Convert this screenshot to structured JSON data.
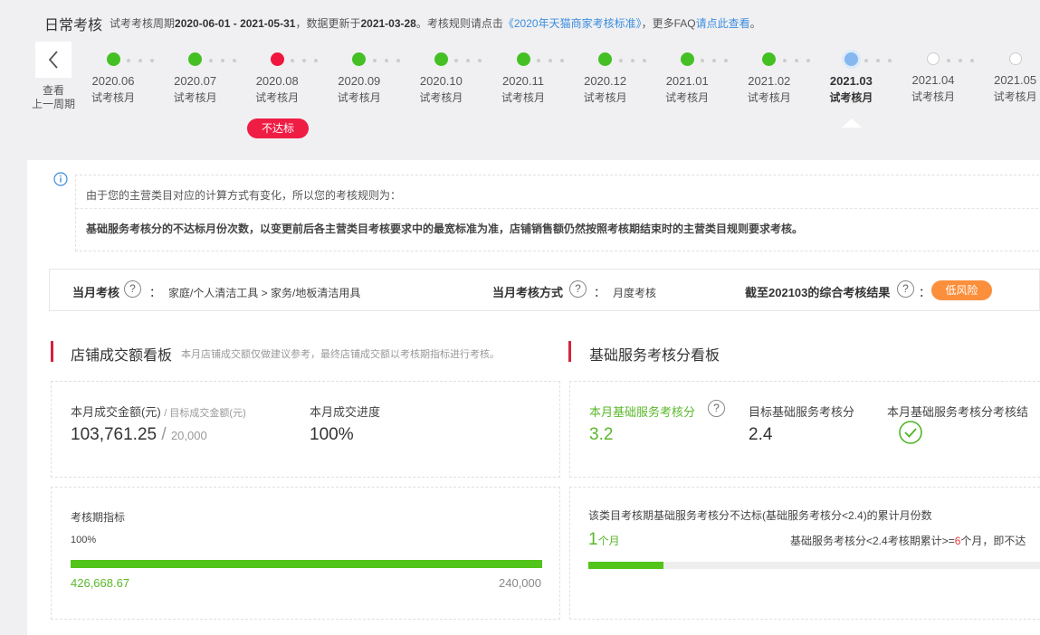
{
  "header": {
    "title": "日常考核",
    "desc_prefix": "试考考核周期",
    "period": "2020-06-01 - 2021-05-31",
    "desc_mid": "，数据更新于",
    "update_date": "2021-03-28",
    "desc_rule": "。考核规则请点击",
    "rule_link": "《2020年天猫商家考核标准》",
    "desc_faq": "，更多FAQ",
    "faq_link": "请点此查看",
    "desc_end": "。"
  },
  "timeline": {
    "prev_label_1": "查看",
    "prev_label_2": "上一周期",
    "items": [
      {
        "month": "2020.06",
        "sub": "试考核月",
        "status": "pass"
      },
      {
        "month": "2020.07",
        "sub": "试考核月",
        "status": "pass"
      },
      {
        "month": "2020.08",
        "sub": "试考核月",
        "status": "fail"
      },
      {
        "month": "2020.09",
        "sub": "试考核月",
        "status": "pass"
      },
      {
        "month": "2020.10",
        "sub": "试考核月",
        "status": "pass"
      },
      {
        "month": "2020.11",
        "sub": "试考核月",
        "status": "pass"
      },
      {
        "month": "2020.12",
        "sub": "试考核月",
        "status": "pass"
      },
      {
        "month": "2021.01",
        "sub": "试考核月",
        "status": "pass"
      },
      {
        "month": "2021.02",
        "sub": "试考核月",
        "status": "pass"
      },
      {
        "month": "2021.03",
        "sub": "试考核月",
        "status": "current"
      },
      {
        "month": "2021.04",
        "sub": "试考核月",
        "status": "future"
      },
      {
        "month": "2021.05",
        "sub": "试考核月",
        "status": "future"
      }
    ],
    "fail_badge": "不达标"
  },
  "notice": {
    "line1": "由于您的主营类目对应的计算方式有变化，所以您的考核规则为：",
    "line2": "基础服务考核分的不达标月份次数，以变更前后各主营类目考核要求中的最宽标准为准，店铺销售额仍然按照考核期结束时的主营类目规则要求考核。"
  },
  "assessment": {
    "month_label": "当月考核",
    "category": "家庭/个人清洁工具 > 家务/地板清洁用具",
    "method_label": "当月考核方式",
    "method_value": "月度考核",
    "result_label": "截至202103的综合考核结果",
    "result_value": "低风险",
    "colon": "：",
    "q_mark": "?"
  },
  "sales_board": {
    "title": "店铺成交额看板",
    "note": "本月店铺成交额仅做建议参考，最终店铺成交额以考核期指标进行考核。",
    "amount_label": "本月成交金额(元)",
    "target_label": "/ 目标成交金额(元)",
    "amount_value": "103,761.25",
    "slash": "/",
    "target_value": "20,000",
    "progress_label": "本月成交进度",
    "progress_value": "100%",
    "period_label": "考核期指标",
    "period_pct": "100%",
    "period_fill": 1.0,
    "period_current": "426,668.67",
    "period_target": "240,000"
  },
  "service_board": {
    "title": "基础服务考核分看板",
    "score_label": "本月基础服务考核分",
    "score_value": "3.2",
    "target_label": "目标基础服务考核分",
    "target_value": "2.4",
    "result_label": "本月基础服务考核分考核结",
    "fail_count_label": "该类目考核期基础服务考核分不达标(基础服务考核分<2.4)的累计月份数",
    "fail_count_value": "1",
    "fail_count_unit": "个月",
    "rule_prefix": "基础服务考核分<2.4考核期累计>=",
    "rule_num": "6",
    "rule_suffix": "个月，即不达",
    "fail_fill": 0.167
  },
  "colors": {
    "pass": "#44c024",
    "fail": "#f0163d",
    "current": "#84b8ee",
    "accent_red": "#d4233c",
    "risk_orange": "#fc8f3c",
    "progress_green": "#52c41a"
  }
}
